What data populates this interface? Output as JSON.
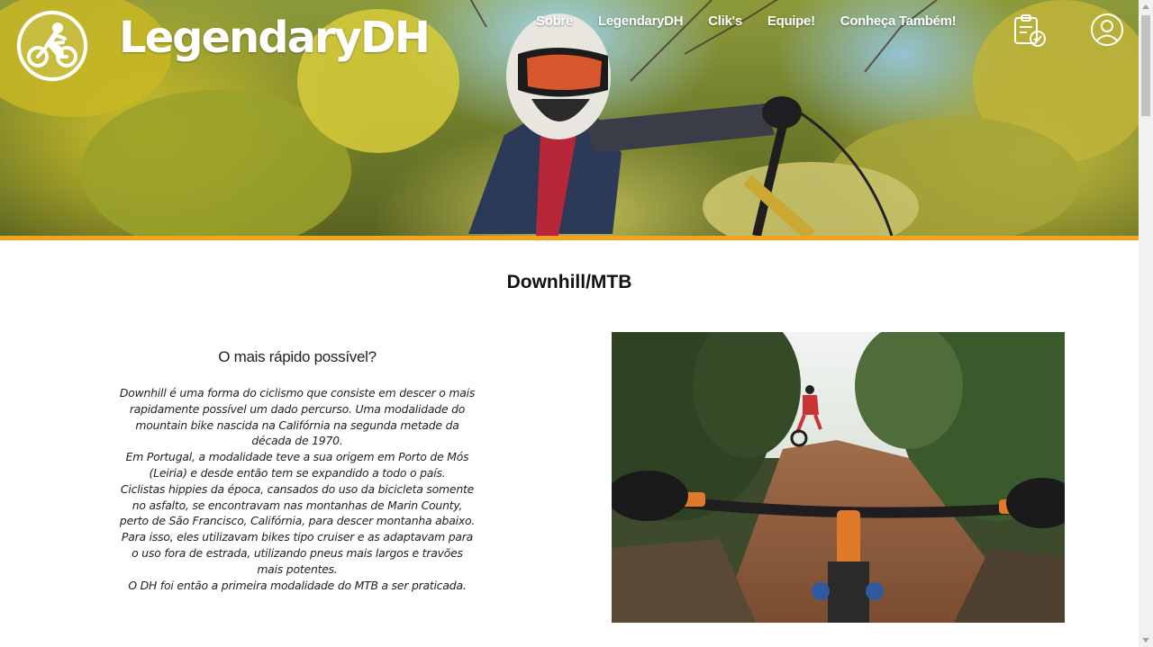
{
  "brand": {
    "title": "LegendaryDH"
  },
  "nav": {
    "items": [
      {
        "label": "Sobre"
      },
      {
        "label": "LegendaryDH"
      },
      {
        "label": "Clik's"
      },
      {
        "label": "Equipe!"
      },
      {
        "label": "Conheça Também!"
      }
    ]
  },
  "header_icons": {
    "checklist": "clipboard-check-icon",
    "account": "user-icon"
  },
  "main": {
    "title": "Downhill/MTB",
    "subheading": "O mais rápido possível?",
    "paragraphs": [
      "Downhill é uma forma do ciclismo que consiste em descer o mais rapidamente possível um dado percurso. Uma modalidade do mountain bike nascida na Califórnia na segunda metade da década de 1970.",
      "Em Portugal, a modalidade teve a sua origem em Porto de Mós (Leiria) e desde então tem se expandido a todo o país.",
      "Ciclistas hippies da época, cansados do uso da bicicleta somente no asfalto, se encontravam nas montanhas de Marin County, perto de São Francisco, Califórnia, para descer montanha abaixo. Para isso, eles utilizavam bikes tipo cruiser e as adaptavam para o uso fora de estrada, utilizando pneus mais largos e travões mais potentes.",
      "O DH foi então a primeira modalidade do MTB a ser praticada."
    ]
  },
  "colors": {
    "accent": "#f2a41c",
    "text": "#222222",
    "nav_text": "#ffffff"
  }
}
